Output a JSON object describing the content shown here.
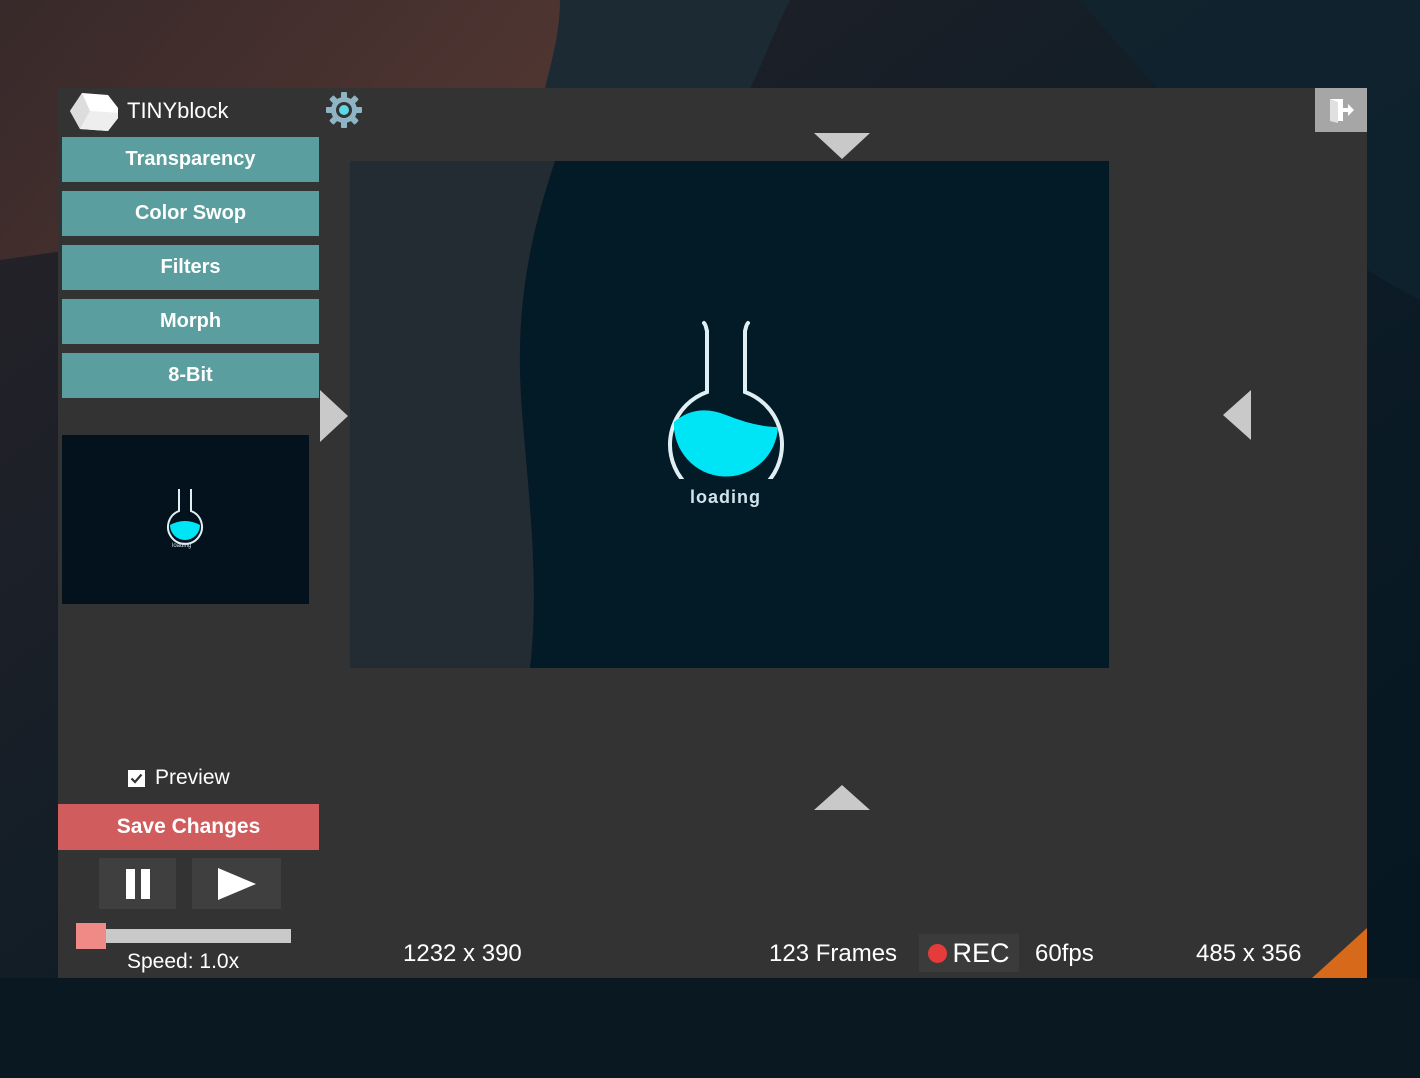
{
  "app": {
    "title": "TINYblock",
    "colors": {
      "window_bg": "#333333",
      "menu_button": "#5b9e9f",
      "save_button": "#d15c5e",
      "accent_corner": "#d66a1a",
      "liquid": "#00e5f5"
    }
  },
  "header": {
    "settings_icon": "gear-icon",
    "exit_icon": "exit-door-icon"
  },
  "sidebar": {
    "buttons": [
      {
        "label": "Transparency"
      },
      {
        "label": "Color Swop"
      },
      {
        "label": "Filters"
      },
      {
        "label": "Morph"
      },
      {
        "label": "8-Bit"
      }
    ]
  },
  "canvas": {
    "loading_text": "loading",
    "thumbnail_text": "loading"
  },
  "controls": {
    "preview_label": "Preview",
    "preview_checked": true,
    "save_label": "Save Changes",
    "pause_icon": "pause-icon",
    "play_icon": "play-icon",
    "speed_label": "Speed: 1.0x",
    "speed_value": 1.0
  },
  "status": {
    "source_size": "1232 x 390",
    "frames": "123 Frames",
    "rec_label": "REC",
    "fps": "60fps",
    "output_size": "485 x 356"
  }
}
